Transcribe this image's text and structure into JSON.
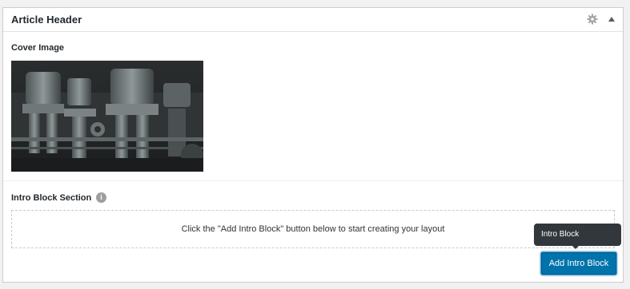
{
  "metabox": {
    "title": "Article Header",
    "settings_icon": "gear-icon",
    "toggle_icon": "triangle-up-icon"
  },
  "cover_image": {
    "label": "Cover Image",
    "image": "photo of vintage steam engine machinery"
  },
  "intro_block": {
    "label": "Intro Block Section",
    "info_icon": "info-icon",
    "empty_message": "Click the \"Add Intro Block\" button below to start creating your layout",
    "add_button_label": "Add Intro Block",
    "tooltip": "Intro Block"
  },
  "colors": {
    "primary_button": "#0073aa",
    "tooltip_bg": "#32373c",
    "border": "#cccccc"
  }
}
